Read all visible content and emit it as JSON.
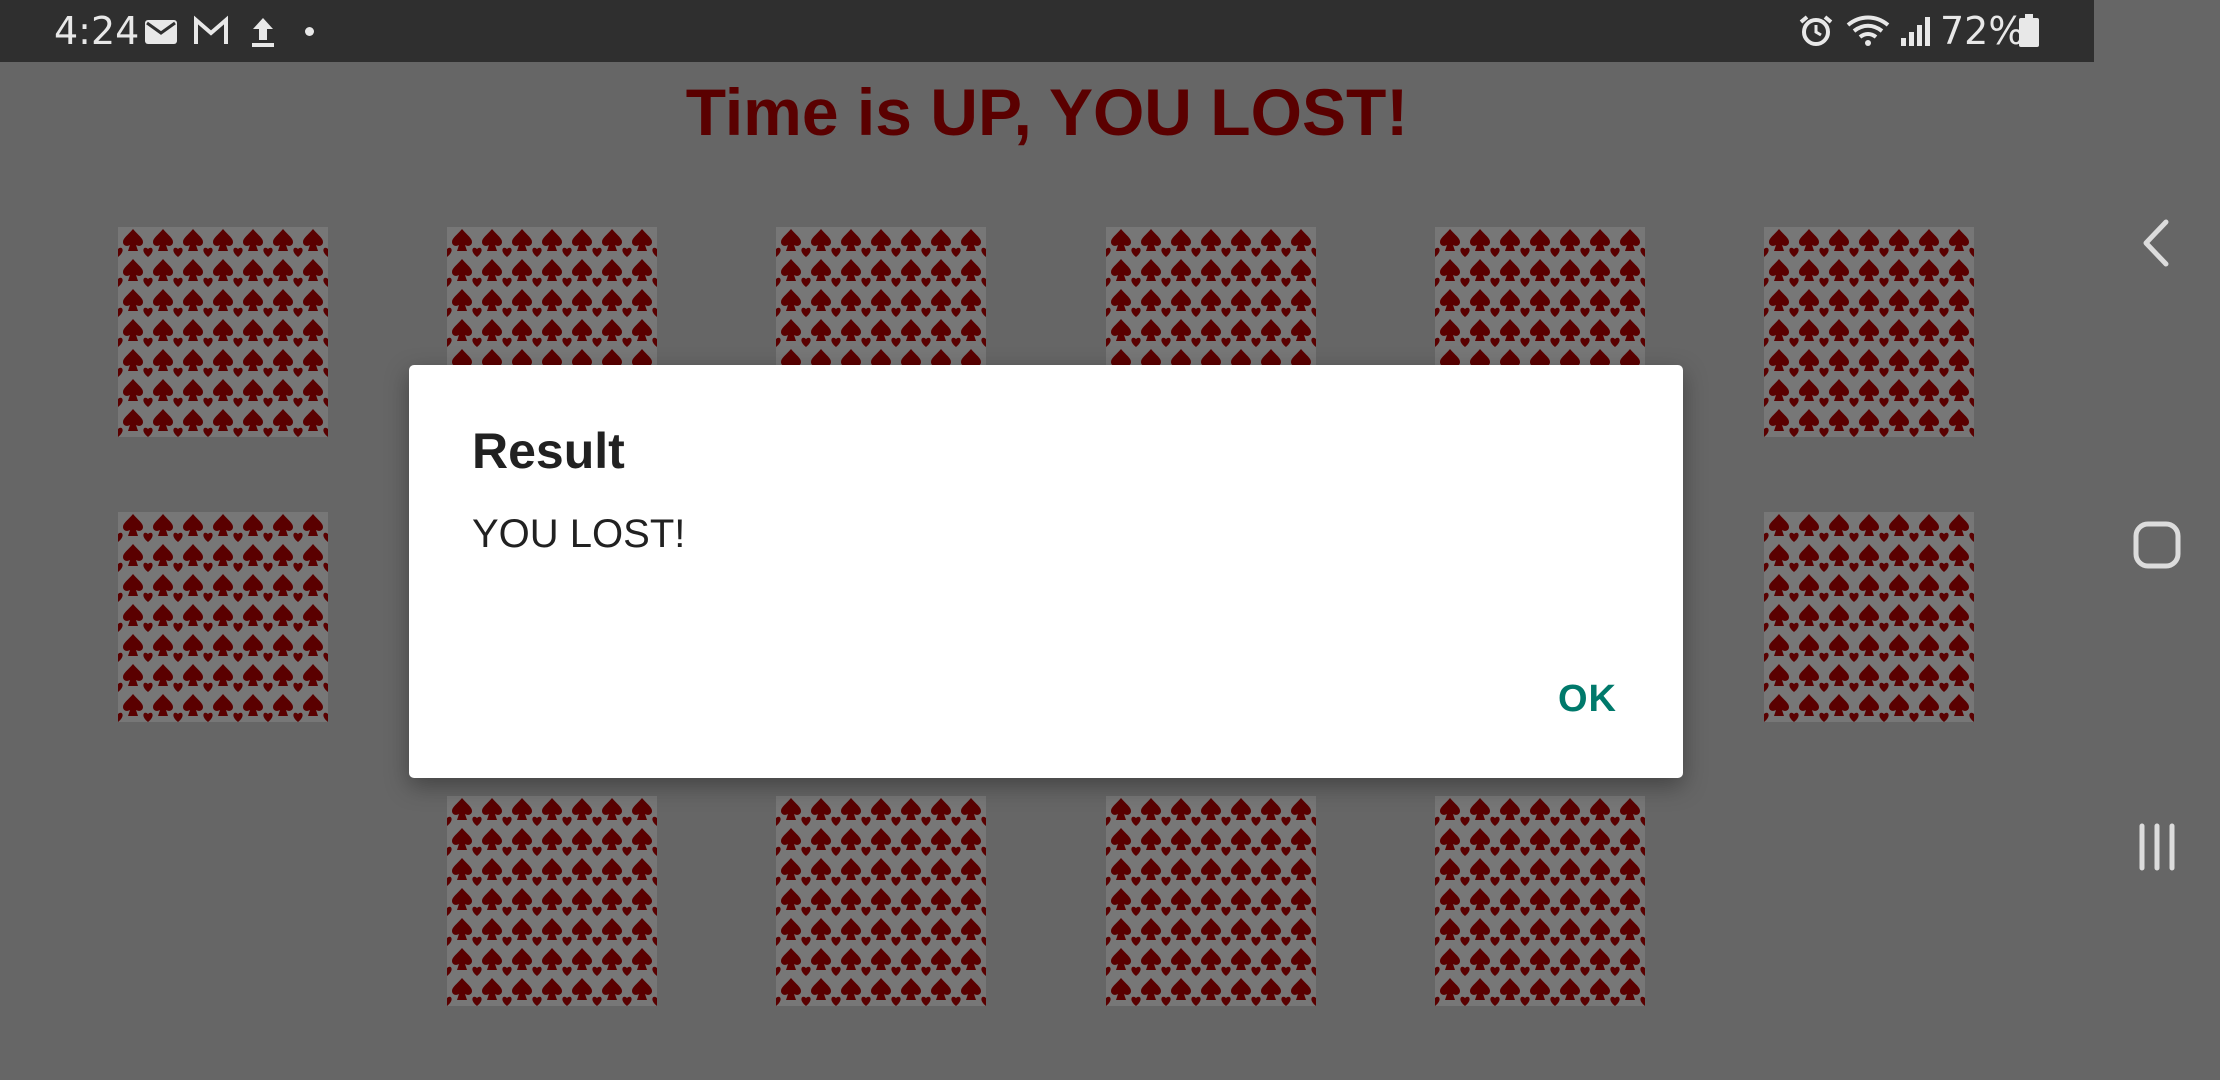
{
  "status_bar": {
    "time": "4:24",
    "battery_text": "72%",
    "left_icons": [
      "mail-icon",
      "gmail-icon",
      "upload-icon",
      "dot-icon"
    ],
    "right_icons": [
      "alarm-icon",
      "wifi-icon",
      "signal-icon",
      "battery-icon"
    ]
  },
  "game": {
    "title": "Time is UP, YOU LOST!",
    "title_color": "#5a0000",
    "card_pattern": "spade-and-heart-pattern",
    "card_color": "#5a0000"
  },
  "dialog": {
    "title": "Result",
    "message": "YOU LOST!",
    "ok_label": "OK",
    "ok_color": "#00796b"
  },
  "nav_bar": {
    "buttons": [
      "back-icon",
      "home-icon",
      "recents-icon"
    ]
  }
}
